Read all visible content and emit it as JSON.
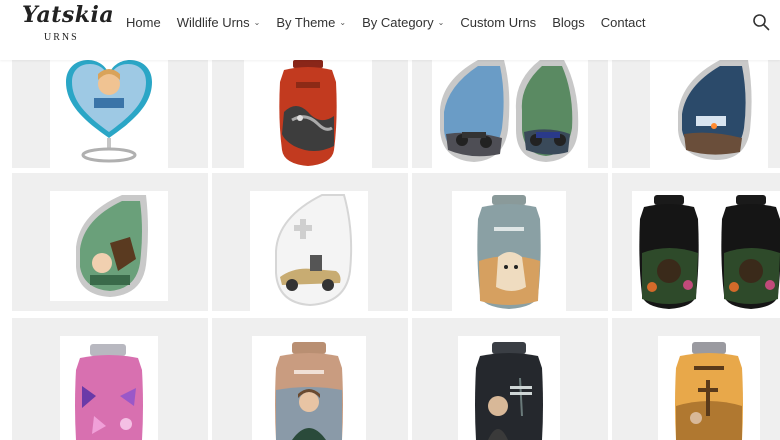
{
  "brand": {
    "name": "Yatskia",
    "sub": "URNS"
  },
  "nav": [
    {
      "label": "Home",
      "dropdown": false
    },
    {
      "label": "Wildlife Urns",
      "dropdown": true
    },
    {
      "label": "By Theme",
      "dropdown": true
    },
    {
      "label": "By Category",
      "dropdown": true
    },
    {
      "label": "Custom Urns",
      "dropdown": false
    },
    {
      "label": "Blogs",
      "dropdown": false
    },
    {
      "label": "Contact",
      "dropdown": false
    }
  ],
  "icons": {
    "search": "search-icon",
    "dropdown": "chevron-down-icon"
  },
  "products": [
    {
      "name": "heart-photo-urn",
      "icon": "heart-urn-icon"
    },
    {
      "name": "dragon-urn",
      "icon": "dragon-urn-icon"
    },
    {
      "name": "motorcycle-teardrop-urns",
      "icon": "motorcycle-urn-icon"
    },
    {
      "name": "teardrop-photo-urn",
      "icon": "teardrop-urn-icon"
    },
    {
      "name": "dog-teardrop-urn",
      "icon": "dog-teardrop-urn-icon"
    },
    {
      "name": "classic-car-teardrop-urn",
      "icon": "car-urn-icon"
    },
    {
      "name": "labrador-urn",
      "icon": "dog-urn-icon"
    },
    {
      "name": "rottweiler-urns",
      "icon": "rottweiler-urn-icon"
    },
    {
      "name": "butterfly-urn",
      "icon": "butterfly-urn-icon"
    },
    {
      "name": "portrait-photo-urn",
      "icon": "portrait-urn-icon"
    },
    {
      "name": "memorial-photo-urn",
      "icon": "memorial-urn-icon"
    },
    {
      "name": "cross-sunset-urn",
      "icon": "cross-urn-icon"
    }
  ]
}
